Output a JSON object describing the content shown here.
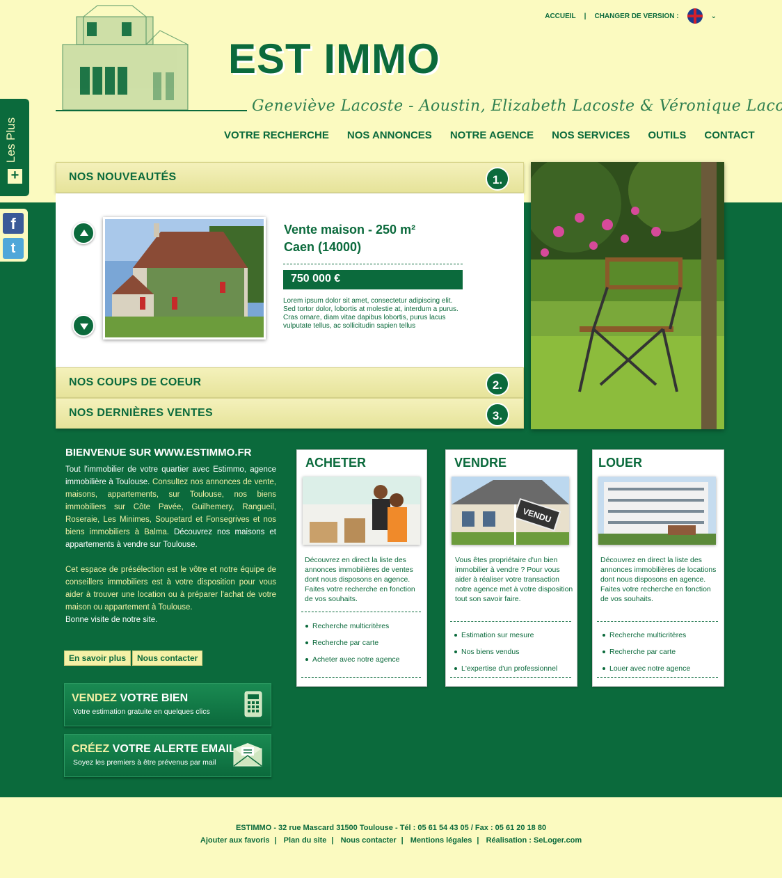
{
  "brand": {
    "name": "EST IMMO",
    "agents": "Geneviève Lacoste - Aoustin, Elizabeth Lacoste & Véronique Lacoste"
  },
  "toplinks": {
    "home": "ACCUEIL",
    "version": "CHANGER DE VERSION :",
    "flag_icon": "uk-flag-icon"
  },
  "nav": [
    "VOTRE RECHERCHE",
    "NOS ANNONCES",
    "NOTRE AGENCE",
    "NOS SERVICES",
    "OUTILS",
    "CONTACT"
  ],
  "sidetab": {
    "label": "Les Plus",
    "plus": "+"
  },
  "social": {
    "facebook": "f",
    "twitter": "t"
  },
  "accordion": {
    "sections": [
      {
        "title": "NOS NOUVEAUTÉS",
        "num": "1."
      },
      {
        "title": "NOS COUPS DE COEUR",
        "num": "2."
      },
      {
        "title": "NOS DERNIÈRES VENTES",
        "num": "3."
      }
    ],
    "listing": {
      "title_line1": "Vente maison - 250 m²",
      "title_line2": "Caen (14000)",
      "price": "750 000 €",
      "description": "Lorem ipsum dolor sit amet, consectetur adipiscing elit. Sed tortor dolor, lobortis at molestie at, interdum a purus. Cras ornare, diam vitae dapibus lobortis, purus lacus vulputate tellus, ac sollicitudin sapien tellus"
    }
  },
  "welcome": {
    "title": "BIENVENUE SUR WWW.ESTIMMO.FR",
    "p1a": "Tout l'immobilier de votre quartier avec Estimmo, agence immobilière à Toulouse.",
    "p1b": " Consultez nos annonces de vente, maisons, appartements, sur Toulouse, nos biens immobiliers sur Côte Pavée, Guilhemery, Rangueil, Roseraie, Les Minimes, Soupetard et Fonsegrives et nos biens immobiliers à Balma.",
    "p1c": " Découvrez nos maisons et appartements à vendre sur Toulouse.",
    "p2a": "Cet espace de présélection est le vôtre et notre équipe de conseillers immobiliers est à votre disposition pour vous aider à trouver une location ou à préparer l'achat de votre maison ou appartement à Toulouse.",
    "p2b": "Bonne visite de notre site.",
    "btn_more": "En savoir plus",
    "btn_contact": "Nous contacter"
  },
  "promos": [
    {
      "hl": "VENDEZ",
      "rest": " VOTRE BIEN",
      "sub": "Votre estimation gratuite en quelques clics",
      "icon": "calculator-icon"
    },
    {
      "hl": "CRÉEZ",
      "rest": " VOTRE ALERTE EMAIL",
      "sub": "Soyez les premiers à être prévenus par mail",
      "icon": "envelope-icon"
    }
  ],
  "cards": [
    {
      "title": "ACHETER",
      "text": "Découvrez en direct la liste des annonces immobilières de ventes dont nous disposons en agence. Faites votre recherche en fonction de vos souhaits.",
      "items": [
        "Recherche multicritères",
        "Recherche par carte",
        "Acheter avec notre agence"
      ]
    },
    {
      "title": "VENDRE",
      "text": "Vous êtes propriétaire d'un bien immobilier à vendre ? Pour vous aider à réaliser votre transaction notre agence met à votre disposition tout son savoir faire.",
      "items": [
        "Estimation sur mesure",
        "Nos biens vendus",
        "L'expertise d'un professionnel"
      ],
      "sign": "VENDU"
    },
    {
      "title": "LOUER",
      "text": "Découvrez en direct la liste des annonces immobilières de locations dont nous disposons en agence. Faites votre recherche en fonction de vos souhaits.",
      "items": [
        "Recherche multicritères",
        "Recherche par carte",
        "Louer avec notre agence"
      ]
    }
  ],
  "footer": {
    "address": "ESTIMMO - 32 rue Mascard 31500 Toulouse - Tél : 05 61 54 43 05 / Fax : 05 61 20 18 80",
    "links": [
      "Ajouter aux favoris",
      "Plan du site",
      "Nous contacter",
      "Mentions légales",
      "Réalisation : SeLoger.com"
    ]
  },
  "colors": {
    "primary": "#0b6a3c",
    "cream": "#fbfac0",
    "accent": "#f4f1a6"
  }
}
